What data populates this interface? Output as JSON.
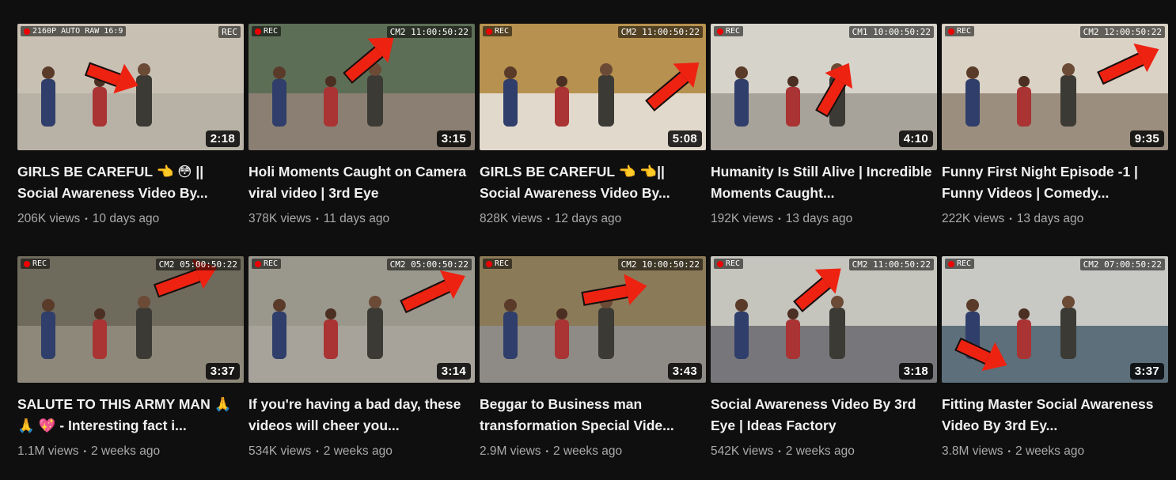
{
  "videos": [
    {
      "title": "GIRLS BE CAREFUL 👈 😳 || Social Awareness Video By...",
      "views": "206K views",
      "age": "10 days ago",
      "duration": "2:18",
      "cam_left": "2160P AUTO RAW 16:9",
      "cam_right": "REC",
      "colors": {
        "sky": "#c9c0b4",
        "ground": "#b8b2a6"
      }
    },
    {
      "title": "Holi Moments Caught on Camera viral video | 3rd Eye",
      "views": "378K views",
      "age": "11 days ago",
      "duration": "3:15",
      "cam_left": "REC",
      "cam_right": "CM2 11:00:50:22",
      "colors": {
        "sky": "#5d6e56",
        "ground": "#8a7f72"
      }
    },
    {
      "title": "GIRLS BE CAREFUL 👈 👈|| Social Awareness Video By...",
      "views": "828K views",
      "age": "12 days ago",
      "duration": "5:08",
      "cam_left": "REC",
      "cam_right": "CM2 11:00:50:22",
      "colors": {
        "sky": "#b7914f",
        "ground": "#e2d9cd"
      }
    },
    {
      "title": "Humanity Is Still Alive | Incredible Moments Caught...",
      "views": "192K views",
      "age": "13 days ago",
      "duration": "4:10",
      "cam_left": "REC",
      "cam_right": "CM1 10:00:50:22",
      "colors": {
        "sky": "#d6d3cb",
        "ground": "#a8a39a"
      }
    },
    {
      "title": "Funny First Night Episode -1 | Funny Videos | Comedy...",
      "views": "222K views",
      "age": "13 days ago",
      "duration": "9:35",
      "cam_left": "REC",
      "cam_right": "CM2 12:00:50:22",
      "colors": {
        "sky": "#d9d2c5",
        "ground": "#9c8e7e"
      }
    },
    {
      "title": "SALUTE TO THIS ARMY MAN 🙏 🙏 💖 - Interesting fact i...",
      "views": "1.1M views",
      "age": "2 weeks ago",
      "duration": "3:37",
      "cam_left": "REC",
      "cam_right": "CM2 05:00:50:22",
      "colors": {
        "sky": "#6e6a5c",
        "ground": "#8d8879"
      }
    },
    {
      "title": "If you're having a bad day, these videos will cheer you...",
      "views": "534K views",
      "age": "2 weeks ago",
      "duration": "3:14",
      "cam_left": "REC",
      "cam_right": "CM2 05:00:50:22",
      "colors": {
        "sky": "#9a978d",
        "ground": "#a7a39b"
      }
    },
    {
      "title": "Beggar to Business man transformation Special Vide...",
      "views": "2.9M views",
      "age": "2 weeks ago",
      "duration": "3:43",
      "cam_left": "REC",
      "cam_right": "CM2 10:00:50:22",
      "colors": {
        "sky": "#8b7a58",
        "ground": "#8e8b86"
      }
    },
    {
      "title": "Social Awareness Video By 3rd Eye | Ideas Factory",
      "views": "542K views",
      "age": "2 weeks ago",
      "duration": "3:18",
      "cam_left": "REC",
      "cam_right": "CM2 11:00:50:22",
      "colors": {
        "sky": "#c5c4bd",
        "ground": "#77767a"
      }
    },
    {
      "title": "Fitting Master Social Awareness Video By 3rd Ey...",
      "views": "3.8M views",
      "age": "2 weeks ago",
      "duration": "3:37",
      "cam_left": "REC",
      "cam_right": "CM2 07:00:50:22",
      "colors": {
        "sky": "#c8c8c4",
        "ground": "#5c6f7a"
      }
    }
  ]
}
